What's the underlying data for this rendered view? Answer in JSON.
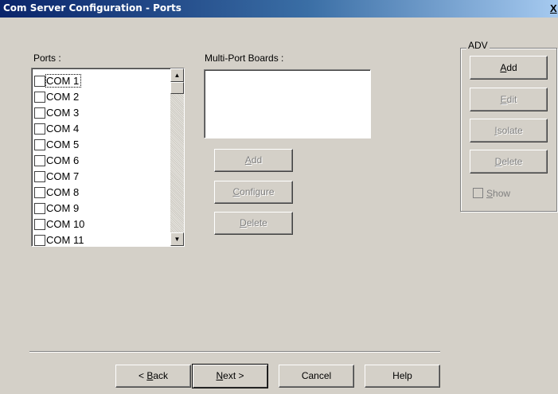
{
  "window": {
    "title": "Com Server Configuration - Ports",
    "close_label": "X"
  },
  "ports": {
    "label": "Ports :",
    "items": [
      "COM 1",
      "COM 2",
      "COM 3",
      "COM 4",
      "COM 5",
      "COM 6",
      "COM 7",
      "COM 8",
      "COM 9",
      "COM 10",
      "COM 11"
    ],
    "scroll_up_icon": "arrow-up-icon",
    "scroll_down_icon": "arrow-down-icon"
  },
  "multiport": {
    "label": "Multi-Port Boards :",
    "add": {
      "pre": "",
      "accel": "A",
      "post": "dd"
    },
    "configure": {
      "pre": "",
      "accel": "C",
      "post": "onfigure"
    },
    "delete": {
      "pre": "",
      "accel": "D",
      "post": "elete"
    }
  },
  "adv": {
    "title": "ADV",
    "add": {
      "pre": "",
      "accel": "A",
      "post": "dd"
    },
    "edit": {
      "pre": "",
      "accel": "E",
      "post": "dit"
    },
    "isolate": {
      "pre": "",
      "accel": "I",
      "post": "solate"
    },
    "delete": {
      "pre": "",
      "accel": "D",
      "post": "elete"
    },
    "show": {
      "pre": "",
      "accel": "S",
      "post": "how"
    }
  },
  "footer": {
    "back": {
      "pre": "< ",
      "accel": "B",
      "post": "ack"
    },
    "next": {
      "pre": "",
      "accel": "N",
      "post": "ext >"
    },
    "cancel": "Cancel",
    "help": "Help"
  }
}
